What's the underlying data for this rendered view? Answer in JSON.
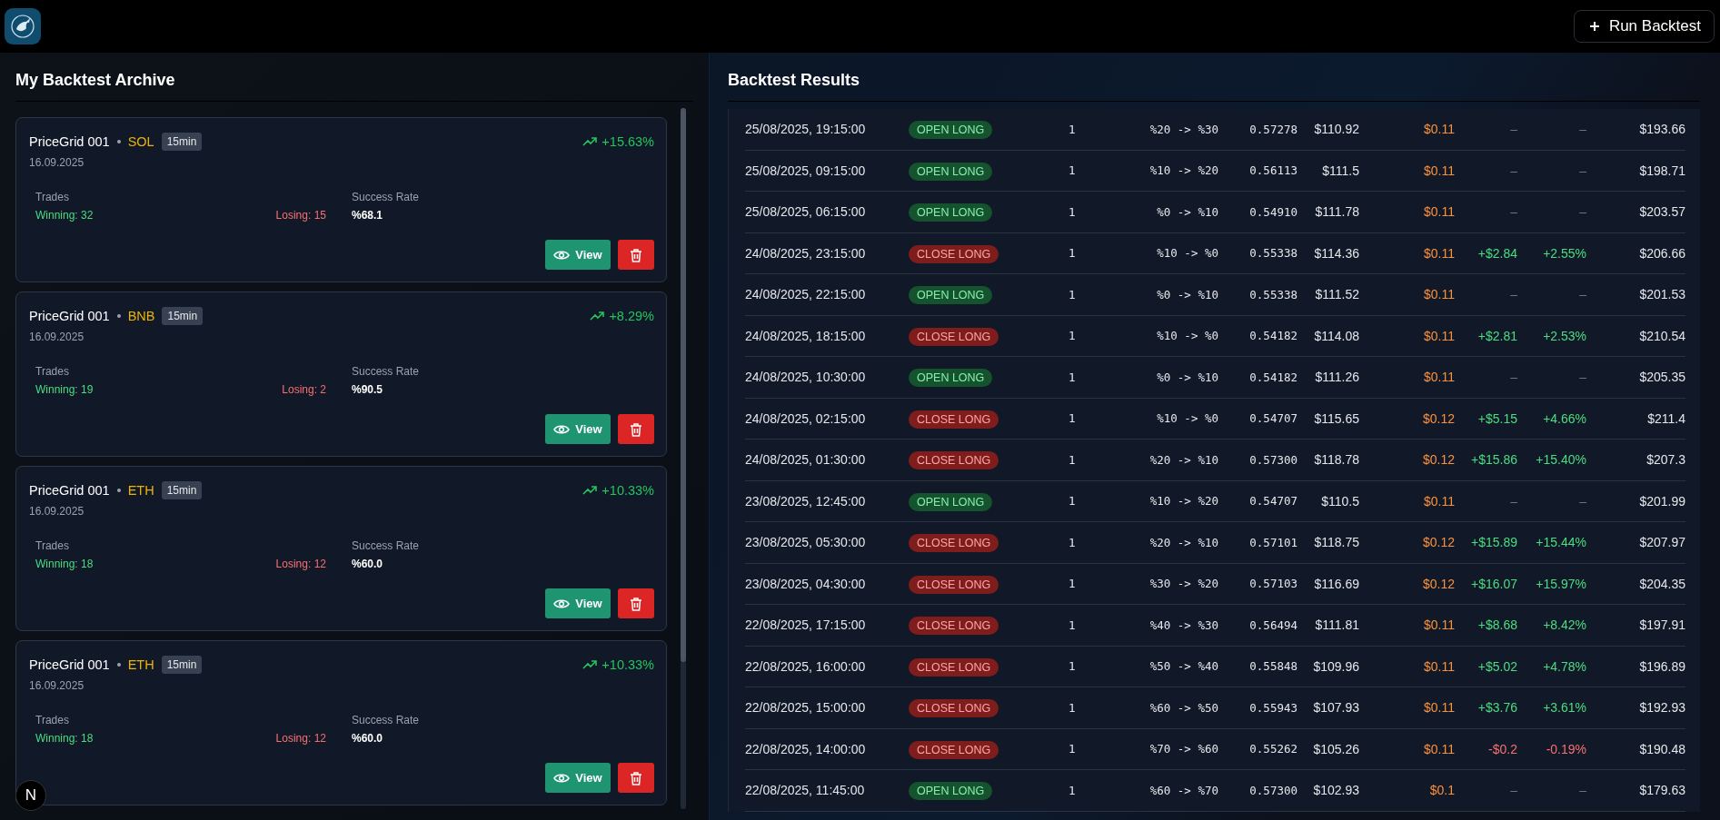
{
  "header": {
    "run_button": "Run Backtest"
  },
  "archive": {
    "title": "My Backtest Archive",
    "cards": [
      {
        "name": "PriceGrid 001",
        "symbol": "SOL",
        "timeframe": "15min",
        "date": "16.09.2025",
        "return": "+15.63%",
        "trades_label": "Trades",
        "winning": "Winning: 32",
        "losing": "Losing: 15",
        "rate_label": "Success Rate",
        "rate": "%68.1",
        "view": "View"
      },
      {
        "name": "PriceGrid 001",
        "symbol": "BNB",
        "timeframe": "15min",
        "date": "16.09.2025",
        "return": "+8.29%",
        "trades_label": "Trades",
        "winning": "Winning: 19",
        "losing": "Losing: 2",
        "rate_label": "Success Rate",
        "rate": "%90.5",
        "view": "View"
      },
      {
        "name": "PriceGrid 001",
        "symbol": "ETH",
        "timeframe": "15min",
        "date": "16.09.2025",
        "return": "+10.33%",
        "trades_label": "Trades",
        "winning": "Winning: 18",
        "losing": "Losing: 12",
        "rate_label": "Success Rate",
        "rate": "%60.0",
        "view": "View"
      },
      {
        "name": "PriceGrid 001",
        "symbol": "ETH",
        "timeframe": "15min",
        "date": "16.09.2025",
        "return": "+10.33%",
        "trades_label": "Trades",
        "winning": "Winning: 18",
        "losing": "Losing: 12",
        "rate_label": "Success Rate",
        "rate": "%60.0",
        "view": "View"
      }
    ]
  },
  "results": {
    "title": "Backtest Results",
    "rows": [
      {
        "time": "25/08/2025, 19:15:00",
        "kind": "open",
        "action": "OPEN LONG",
        "qty": "1",
        "range": "%20 -> %30",
        "price": "0.57278",
        "value": "$110.92",
        "fee": "$0.11",
        "pnl": {
          "kind": "none",
          "amount": "–",
          "percent": "–"
        },
        "balance": "$193.66"
      },
      {
        "time": "25/08/2025, 09:15:00",
        "kind": "open",
        "action": "OPEN LONG",
        "qty": "1",
        "range": "%10 -> %20",
        "price": "0.56113",
        "value": "$111.5",
        "fee": "$0.11",
        "pnl": {
          "kind": "none",
          "amount": "–",
          "percent": "–"
        },
        "balance": "$198.71"
      },
      {
        "time": "25/08/2025, 06:15:00",
        "kind": "open",
        "action": "OPEN LONG",
        "qty": "1",
        "range": "%0 -> %10",
        "price": "0.54910",
        "value": "$111.78",
        "fee": "$0.11",
        "pnl": {
          "kind": "none",
          "amount": "–",
          "percent": "–"
        },
        "balance": "$203.57"
      },
      {
        "time": "24/08/2025, 23:15:00",
        "kind": "close",
        "action": "CLOSE LONG",
        "qty": "1",
        "range": "%10 -> %0",
        "price": "0.55338",
        "value": "$114.36",
        "fee": "$0.11",
        "pnl": {
          "kind": "gain",
          "amount": "+$2.84",
          "percent": "+2.55%"
        },
        "balance": "$206.66"
      },
      {
        "time": "24/08/2025, 22:15:00",
        "kind": "open",
        "action": "OPEN LONG",
        "qty": "1",
        "range": "%0 -> %10",
        "price": "0.55338",
        "value": "$111.52",
        "fee": "$0.11",
        "pnl": {
          "kind": "none",
          "amount": "–",
          "percent": "–"
        },
        "balance": "$201.53"
      },
      {
        "time": "24/08/2025, 18:15:00",
        "kind": "close",
        "action": "CLOSE LONG",
        "qty": "1",
        "range": "%10 -> %0",
        "price": "0.54182",
        "value": "$114.08",
        "fee": "$0.11",
        "pnl": {
          "kind": "gain",
          "amount": "+$2.81",
          "percent": "+2.53%"
        },
        "balance": "$210.54"
      },
      {
        "time": "24/08/2025, 10:30:00",
        "kind": "open",
        "action": "OPEN LONG",
        "qty": "1",
        "range": "%0 -> %10",
        "price": "0.54182",
        "value": "$111.26",
        "fee": "$0.11",
        "pnl": {
          "kind": "none",
          "amount": "–",
          "percent": "–"
        },
        "balance": "$205.35"
      },
      {
        "time": "24/08/2025, 02:15:00",
        "kind": "close",
        "action": "CLOSE LONG",
        "qty": "1",
        "range": "%10 -> %0",
        "price": "0.54707",
        "value": "$115.65",
        "fee": "$0.12",
        "pnl": {
          "kind": "gain",
          "amount": "+$5.15",
          "percent": "+4.66%"
        },
        "balance": "$211.4"
      },
      {
        "time": "24/08/2025, 01:30:00",
        "kind": "close",
        "action": "CLOSE LONG",
        "qty": "1",
        "range": "%20 -> %10",
        "price": "0.57300",
        "value": "$118.78",
        "fee": "$0.12",
        "pnl": {
          "kind": "gain",
          "amount": "+$15.86",
          "percent": "+15.40%"
        },
        "balance": "$207.3"
      },
      {
        "time": "23/08/2025, 12:45:00",
        "kind": "open",
        "action": "OPEN LONG",
        "qty": "1",
        "range": "%10 -> %20",
        "price": "0.54707",
        "value": "$110.5",
        "fee": "$0.11",
        "pnl": {
          "kind": "none",
          "amount": "–",
          "percent": "–"
        },
        "balance": "$201.99"
      },
      {
        "time": "23/08/2025, 05:30:00",
        "kind": "close",
        "action": "CLOSE LONG",
        "qty": "1",
        "range": "%20 -> %10",
        "price": "0.57101",
        "value": "$118.75",
        "fee": "$0.12",
        "pnl": {
          "kind": "gain",
          "amount": "+$15.89",
          "percent": "+15.44%"
        },
        "balance": "$207.97"
      },
      {
        "time": "23/08/2025, 04:30:00",
        "kind": "close",
        "action": "CLOSE LONG",
        "qty": "1",
        "range": "%30 -> %20",
        "price": "0.57103",
        "value": "$116.69",
        "fee": "$0.12",
        "pnl": {
          "kind": "gain",
          "amount": "+$16.07",
          "percent": "+15.97%"
        },
        "balance": "$204.35"
      },
      {
        "time": "22/08/2025, 17:15:00",
        "kind": "close",
        "action": "CLOSE LONG",
        "qty": "1",
        "range": "%40 -> %30",
        "price": "0.56494",
        "value": "$111.81",
        "fee": "$0.11",
        "pnl": {
          "kind": "gain",
          "amount": "+$8.68",
          "percent": "+8.42%"
        },
        "balance": "$197.91"
      },
      {
        "time": "22/08/2025, 16:00:00",
        "kind": "close",
        "action": "CLOSE LONG",
        "qty": "1",
        "range": "%50 -> %40",
        "price": "0.55848",
        "value": "$109.96",
        "fee": "$0.11",
        "pnl": {
          "kind": "gain",
          "amount": "+$5.02",
          "percent": "+4.78%"
        },
        "balance": "$196.89"
      },
      {
        "time": "22/08/2025, 15:00:00",
        "kind": "close",
        "action": "CLOSE LONG",
        "qty": "1",
        "range": "%60 -> %50",
        "price": "0.55943",
        "value": "$107.93",
        "fee": "$0.11",
        "pnl": {
          "kind": "gain",
          "amount": "+$3.76",
          "percent": "+3.61%"
        },
        "balance": "$192.93"
      },
      {
        "time": "22/08/2025, 14:00:00",
        "kind": "close",
        "action": "CLOSE LONG",
        "qty": "1",
        "range": "%70 -> %60",
        "price": "0.55262",
        "value": "$105.26",
        "fee": "$0.11",
        "pnl": {
          "kind": "loss",
          "amount": "-$0.2",
          "percent": "-0.19%"
        },
        "balance": "$190.48"
      },
      {
        "time": "22/08/2025, 11:45:00",
        "kind": "open",
        "action": "OPEN LONG",
        "qty": "1",
        "range": "%60 -> %70",
        "price": "0.57300",
        "value": "$102.93",
        "fee": "$0.1",
        "pnl": {
          "kind": "none",
          "amount": "–",
          "percent": "–"
        },
        "balance": "$179.63"
      }
    ]
  },
  "dev_badge": "N"
}
